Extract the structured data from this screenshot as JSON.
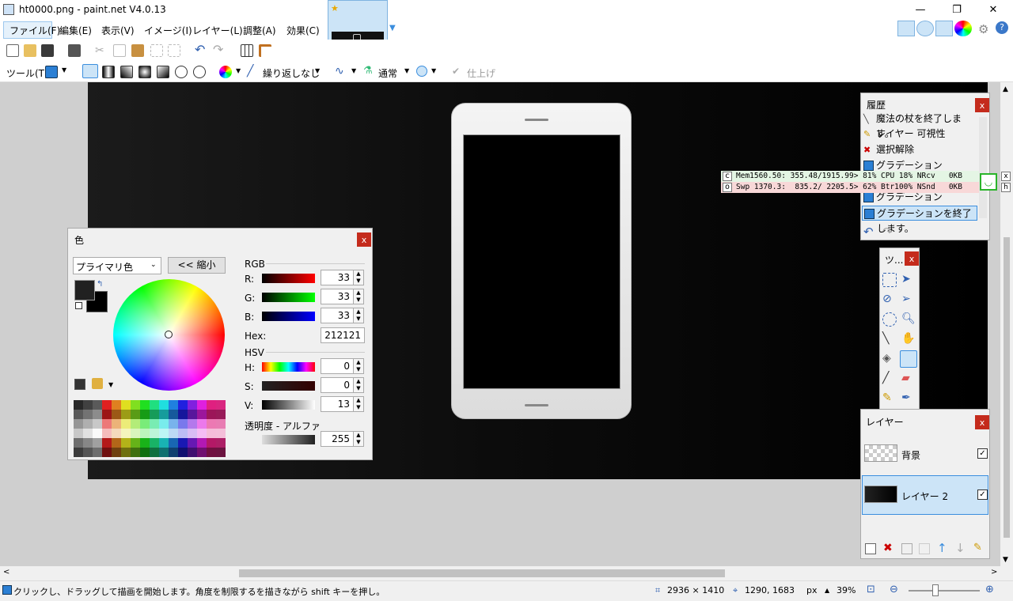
{
  "window": {
    "title": "ht0000.png - paint.net V4.0.13"
  },
  "menu": [
    "ファイル(F)",
    "編集(E)",
    "表示(V)",
    "イメージ(I)",
    "レイヤー(L)",
    "調整(A)",
    "効果(C)"
  ],
  "toolbar2": {
    "tool_label": "ツール(T):",
    "wrap_mode": "繰り返しなし",
    "blend_mode": "通常",
    "finish_label": "仕上げ"
  },
  "color_panel": {
    "title": "色",
    "mode_select": "プライマリ色",
    "shrink_button": "<< 縮小",
    "rgb_label": "RGB",
    "r_label": "R:",
    "g_label": "G:",
    "b_label": "B:",
    "r": "33",
    "g": "33",
    "b": "33",
    "hex_label": "Hex:",
    "hex": "212121",
    "hsv_label": "HSV",
    "h_label": "H:",
    "s_label": "S:",
    "v_label": "V:",
    "h": "0",
    "s": "0",
    "v": "13",
    "alpha_label": "透明度 - アルファ",
    "alpha": "255",
    "primary_color": "#212121",
    "secondary_color": "#000000"
  },
  "history": {
    "title": "履歴",
    "items": [
      "魔法の杖を終了します。",
      "レイヤー 可視性",
      "選択解除",
      "グラデーション",
      "グラデーション",
      "グラデーションを終了します。"
    ]
  },
  "perf": {
    "row1_prefix": "c",
    "row1": "Mem1560.50: 355.48/1915.99> 81% CPU 18% NRcv   0KB",
    "row2_prefix": "o",
    "row2": "Swp 1370.3:  835.2/ 2205.5> 62% Btr100% NSnd   0KB",
    "close": "x",
    "hide": "h"
  },
  "tools_panel": {
    "title": "ツ..."
  },
  "layers": {
    "title": "レイヤー",
    "items": [
      {
        "name": "背景",
        "checked": "✓"
      },
      {
        "name": "レイヤー 2",
        "checked": "✓"
      }
    ]
  },
  "status": {
    "hint": "クリックし、ドラッグして描画を開始します。角度を制限するを描きながら shift キーを押し。",
    "image_size": "2936 × 1410",
    "cursor_pos": "1290, 1683",
    "unit": "px",
    "zoom": "39%"
  },
  "icons": [
    "app-icon",
    "new-icon",
    "open-icon",
    "save-icon",
    "print-icon",
    "cut-icon",
    "copy-icon",
    "paste-icon",
    "crop-icon",
    "undo-icon",
    "redo-icon",
    "grid-icon",
    "ruler-icon",
    "gradient-icon",
    "star-icon",
    "help-icon",
    "settings-icon"
  ]
}
